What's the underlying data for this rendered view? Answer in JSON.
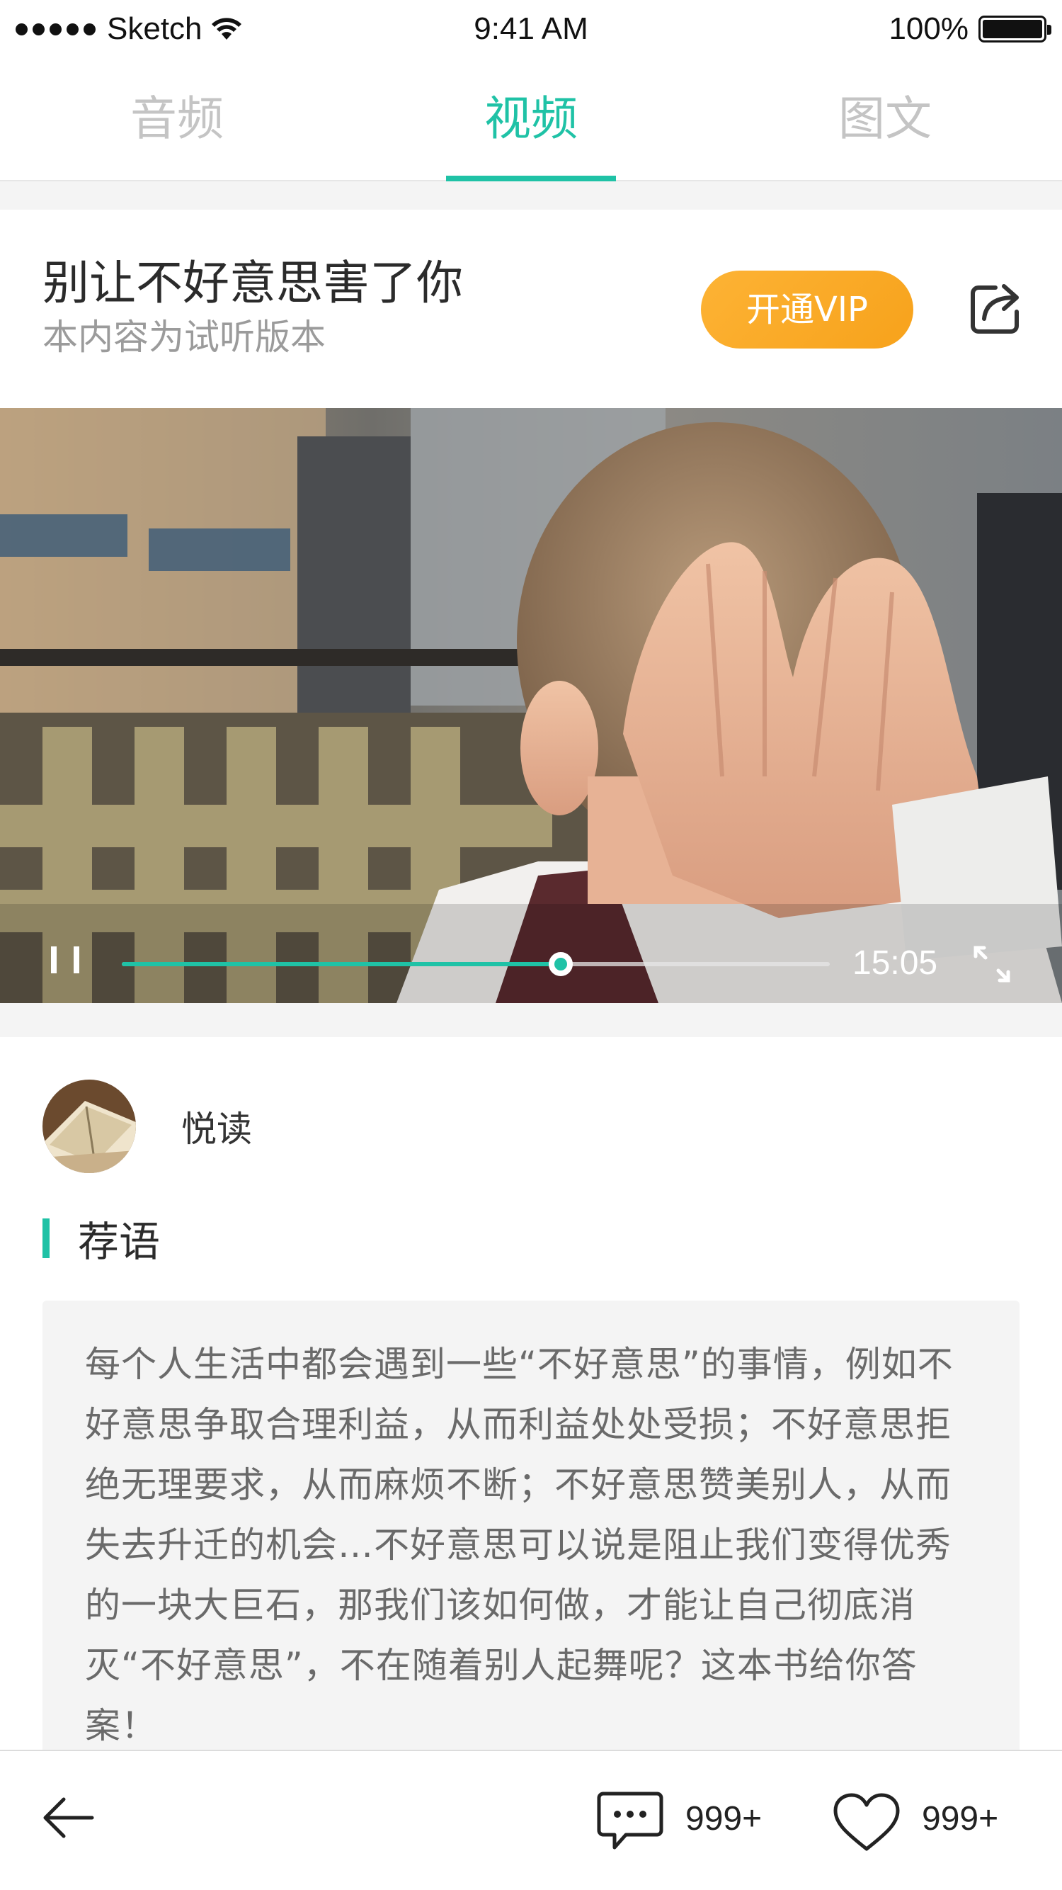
{
  "status_bar": {
    "carrier": "Sketch",
    "time": "9:41 AM",
    "battery": "100%"
  },
  "tabs": [
    {
      "label": "音频",
      "active": false
    },
    {
      "label": "视频",
      "active": true
    },
    {
      "label": "图文",
      "active": false
    }
  ],
  "header": {
    "title": "别让不好意思害了你",
    "subtitle": "本内容为试听版本",
    "vip_button": "开通VIP",
    "share_icon": "share-icon"
  },
  "player": {
    "progress": 0.62,
    "duration": "15:05",
    "pause_icon": "pause-icon",
    "fullscreen_icon": "fullscreen-icon"
  },
  "author": {
    "name": "悦读",
    "avatar_icon": "book-avatar"
  },
  "recommendation": {
    "heading": "荐语",
    "text": "每个人生活中都会遇到一些“不好意思”的事情，例如不好意思争取合理利益，从而利益处处受损；不好意思拒绝无理要求，从而麻烦不断；不好意思赞美别人，从而失去升迁的机会…不好意思可以说是阻止我们变得优秀的一块大巨石，那我们该如何做，才能让自己彻底消灭“不好意思”，不在随着别人起舞呢？这本书给你答案！"
  },
  "bottom_bar": {
    "back_icon": "back-arrow-icon",
    "comment_count": "999+",
    "like_count": "999+"
  },
  "colors": {
    "accent": "#1fc2a6",
    "vip": "#f9a825",
    "muted": "#9b9b9b"
  }
}
